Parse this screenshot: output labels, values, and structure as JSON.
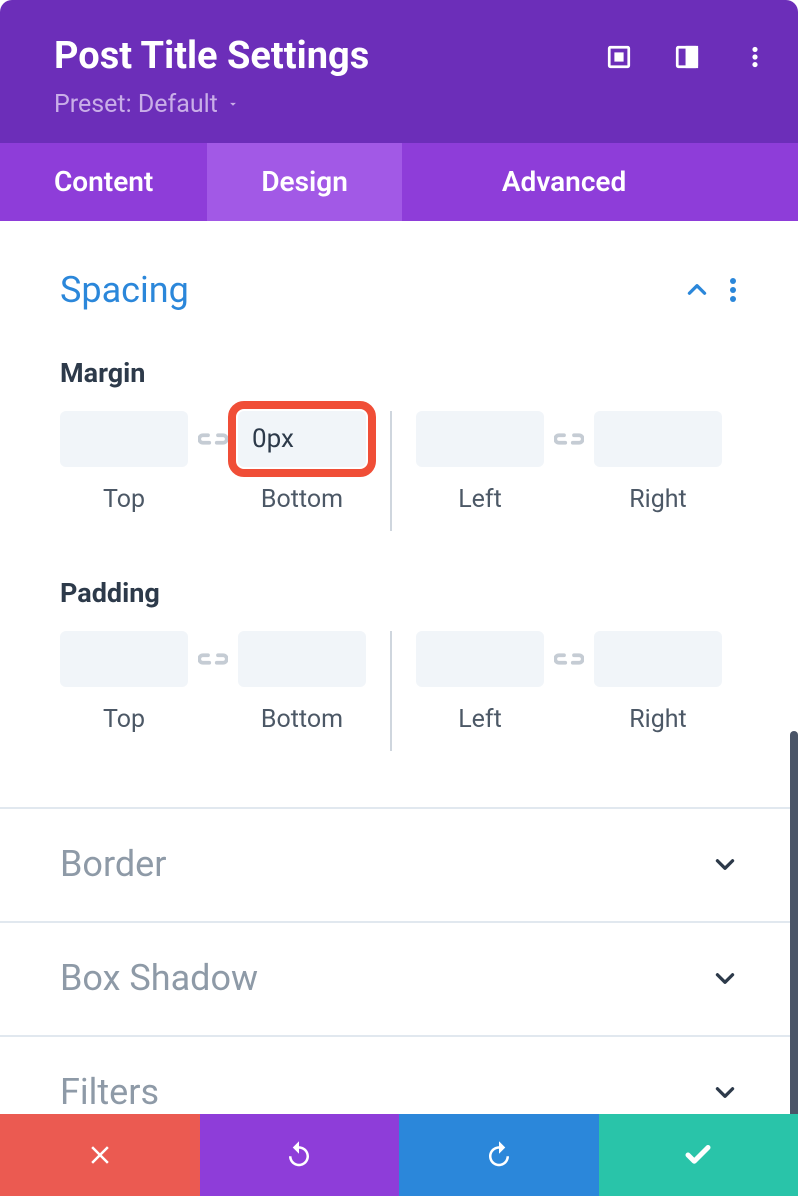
{
  "header": {
    "title": "Post Title Settings",
    "preset_label": "Preset: Default"
  },
  "tabs": {
    "content": "Content",
    "design": "Design",
    "advanced": "Advanced",
    "active": "design"
  },
  "sections": {
    "spacing": {
      "title": "Spacing",
      "margin": {
        "label": "Margin",
        "top": {
          "value": "",
          "label": "Top"
        },
        "bottom": {
          "value": "0px",
          "label": "Bottom"
        },
        "left": {
          "value": "",
          "label": "Left"
        },
        "right": {
          "value": "",
          "label": "Right"
        }
      },
      "padding": {
        "label": "Padding",
        "top": {
          "value": "",
          "label": "Top"
        },
        "bottom": {
          "value": "",
          "label": "Bottom"
        },
        "left": {
          "value": "",
          "label": "Left"
        },
        "right": {
          "value": "",
          "label": "Right"
        }
      }
    },
    "border": {
      "title": "Border"
    },
    "box_shadow": {
      "title": "Box Shadow"
    },
    "filters": {
      "title": "Filters"
    }
  }
}
